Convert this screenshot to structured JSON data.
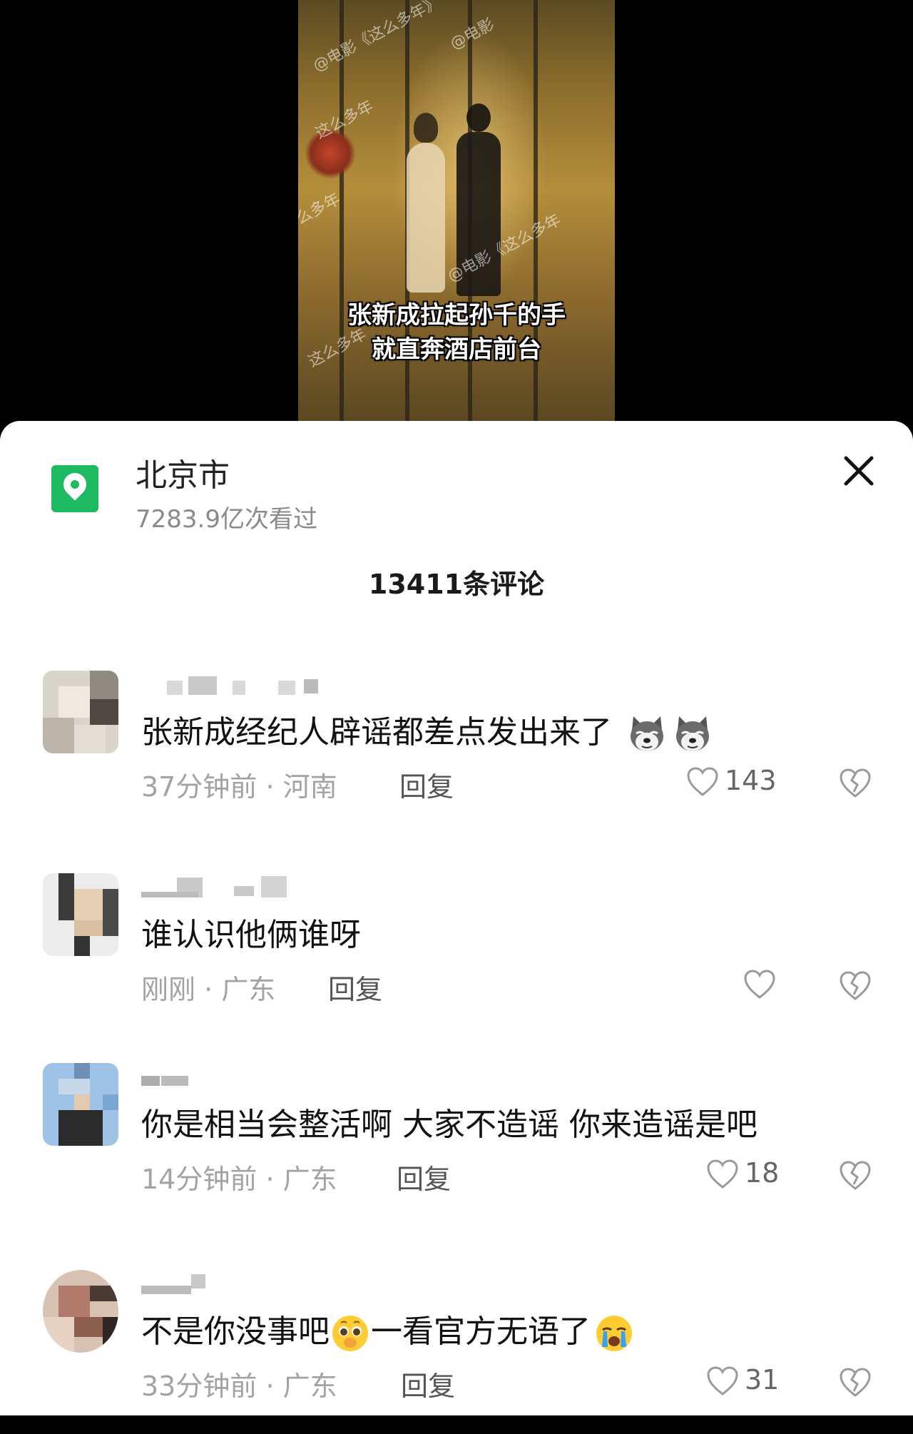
{
  "video": {
    "subtitle_line1": "张新成拉起孙千的手",
    "subtitle_line2": "就直奔酒店前台",
    "watermarks": [
      "@电影《这么多年》",
      "@电影",
      "这么多年",
      "么多年",
      "@电影《这么多年",
      "这么多年"
    ]
  },
  "location": {
    "name": "北京市",
    "views": "7283.9亿次看过",
    "icon": "map-pin-icon",
    "color": "#1dba62"
  },
  "comments_header": {
    "count_label": "13411条评论"
  },
  "comments": [
    {
      "text": "张新成经纪人辟谣都差点发出来了",
      "emojis": [
        "dog-face-emoji",
        "dog-face-emoji"
      ],
      "time": "37分钟前",
      "region": "河南",
      "reply_label": "回复",
      "likes": "143"
    },
    {
      "text": "谁认识他俩谁呀",
      "time": "刚刚",
      "region": "广东",
      "reply_label": "回复",
      "likes": ""
    },
    {
      "text": "你是相当会整活啊 大家不造谣 你来造谣是吧",
      "time": "14分钟前",
      "region": "广东",
      "reply_label": "回复",
      "likes": "18"
    },
    {
      "text_part1": "不是你没事吧",
      "text_part2": "一看官方无语了",
      "emojis": [
        "pleading-face-emoji",
        "crying-face-emoji"
      ],
      "time": "33分钟前",
      "region": "广东",
      "reply_label": "回复",
      "likes": "31"
    }
  ],
  "meta_separator": " · "
}
